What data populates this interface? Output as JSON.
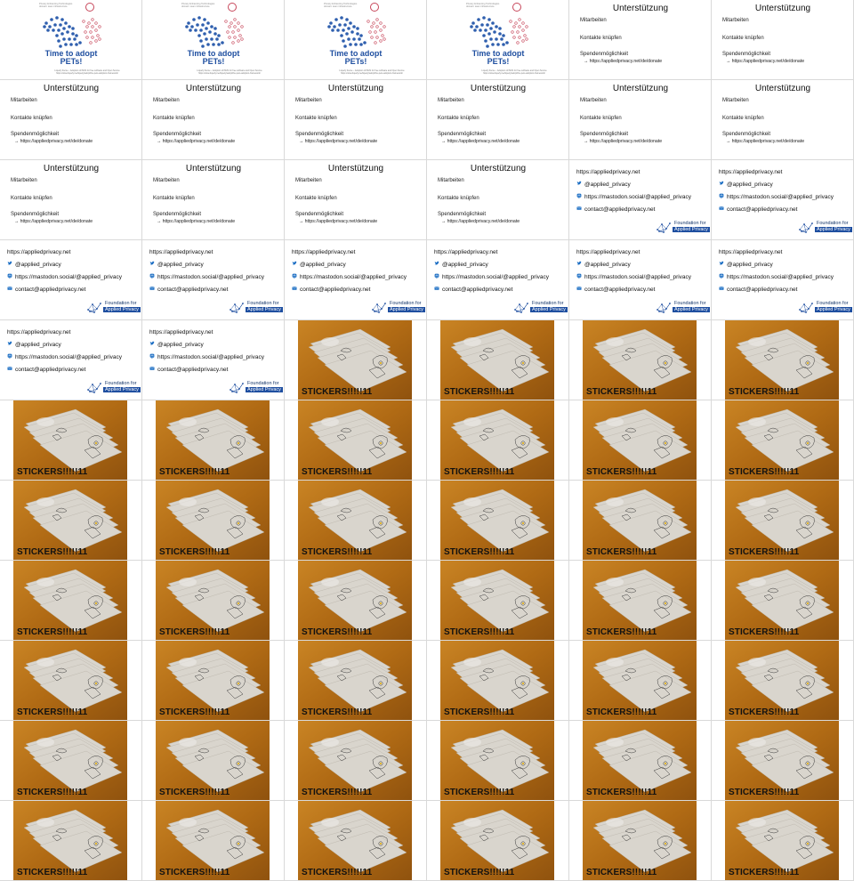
{
  "title_slide": {
    "header_lines": [
      "Privacy Enhancing Technologies",
      "domain: team infrastructure"
    ],
    "title_line1": "Time to adopt",
    "title_line2": "PETs!",
    "footer_lines": [
      "Liquefy theme – Adoption of PETs for free software and Open Source",
      "https://www.liquefy.me/liquefy/adopt/the-pets-adoption-framework/"
    ],
    "colors": {
      "title": "#1f4fa0",
      "dog": "#2f5fae",
      "cat": "#c7465a"
    }
  },
  "support_slide": {
    "title": "Unterstützung",
    "line1": "Mitarbeiten",
    "line2": "Kontakte knüpfen",
    "line3": "Spendenmöglichkeit",
    "donate_link": "→ https://appliedprivacy.net/de/donate"
  },
  "contact_slide": {
    "url": "https://appliedprivacy.net",
    "twitter": "@applied_privacy",
    "mastodon": "https://mastodon.social/@applied_privacy",
    "email": "contact@appliedprivacy.net",
    "badge_top": "Foundation for",
    "badge_bottom": "Applied Privacy",
    "icons": [
      "twitter-icon",
      "mastodon-icon",
      "email-icon"
    ],
    "colors": {
      "icon": "#1d6fc4",
      "badge": "#1f4fa0"
    }
  },
  "sticker_slide": {
    "label": "STICKERS!!!!!11",
    "colors": {
      "table": "#b5731b",
      "paper": "#d8d4cc"
    }
  },
  "slides": [
    "title",
    "title",
    "title",
    "title",
    "support",
    "support",
    "support",
    "support",
    "support",
    "support",
    "support",
    "support",
    "support",
    "support",
    "support",
    "support",
    "contact",
    "contact",
    "contact",
    "contact",
    "contact",
    "contact",
    "contact",
    "contact",
    "contact",
    "contact",
    "sticker",
    "sticker",
    "sticker",
    "sticker",
    "sticker",
    "sticker",
    "sticker",
    "sticker",
    "sticker",
    "sticker",
    "sticker",
    "sticker",
    "sticker",
    "sticker",
    "sticker",
    "sticker",
    "sticker",
    "sticker",
    "sticker",
    "sticker",
    "sticker",
    "sticker",
    "sticker",
    "sticker",
    "sticker",
    "sticker",
    "sticker",
    "sticker",
    "sticker",
    "sticker",
    "sticker",
    "sticker",
    "sticker",
    "sticker",
    "sticker",
    "sticker",
    "sticker",
    "sticker",
    "sticker",
    "sticker"
  ]
}
